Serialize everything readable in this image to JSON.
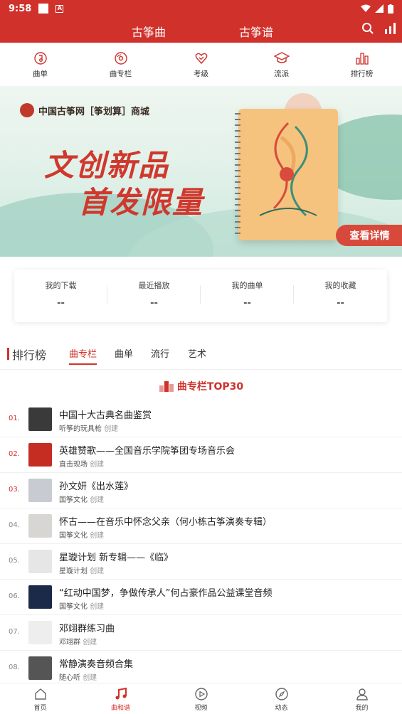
{
  "status": {
    "time": "9:58",
    "a_label": "A"
  },
  "tabs": {
    "left": "古筝曲",
    "right": "古筝谱"
  },
  "categories": [
    {
      "label": "曲单",
      "icon": "music-note-circle-icon"
    },
    {
      "label": "曲专栏",
      "icon": "album-icon"
    },
    {
      "label": "考级",
      "icon": "heart-certificate-icon"
    },
    {
      "label": "流派",
      "icon": "graduation-cap-icon"
    },
    {
      "label": "排行榜",
      "icon": "ranking-icon"
    }
  ],
  "banner": {
    "brand": "中国古筝网［筝划算］商城",
    "headline1": "文创新品",
    "headline2": "首发限量",
    "cta": "查看详情"
  },
  "stats": [
    {
      "label": "我的下载",
      "value": "--"
    },
    {
      "label": "最近播放",
      "value": "--"
    },
    {
      "label": "我的曲单",
      "value": "--"
    },
    {
      "label": "我的收藏",
      "value": "--"
    }
  ],
  "rank": {
    "title": "排行榜",
    "tabs": [
      "曲专栏",
      "曲单",
      "流行",
      "艺术"
    ],
    "active_tab": "曲专栏",
    "top_label": "曲专栏TOP30"
  },
  "items": [
    {
      "rank": "01.",
      "title": "中国十大古典名曲鉴赏",
      "author": "听筝的玩具枪",
      "suffix": "创建",
      "thumb": "#3a3a3a"
    },
    {
      "rank": "02.",
      "title": "英雄赞歌——全国音乐学院筝团专场音乐会",
      "author": "直击现场",
      "suffix": "创建",
      "thumb": "#c62d22"
    },
    {
      "rank": "03.",
      "title": "孙文妍《出水莲》",
      "author": "国筝文化",
      "suffix": "创建",
      "thumb": "#c9cbd3"
    },
    {
      "rank": "04.",
      "title": "怀古——在音乐中怀念父亲（何小栋古筝演奏专辑）",
      "author": "国筝文化",
      "suffix": "创建",
      "thumb": "#d8d6d2"
    },
    {
      "rank": "05.",
      "title": "星璇计划 新专辑——《临》",
      "author": "星璇计划",
      "suffix": "创建",
      "thumb": "#e6e6e6"
    },
    {
      "rank": "06.",
      "title": "“红动中国梦，争做传承人”何占豪作品公益课堂音频",
      "author": "国筝文化",
      "suffix": "创建",
      "thumb": "#1c2a4a"
    },
    {
      "rank": "07.",
      "title": "邓翊群练习曲",
      "author": "邓翊群",
      "suffix": "创建",
      "thumb": "#eeeeee"
    },
    {
      "rank": "08.",
      "title": "常静演奏音频合集",
      "author": "随心听",
      "suffix": "创建",
      "thumb": "#555555"
    }
  ],
  "bottom_nav": [
    {
      "label": "首页",
      "icon": "home-icon"
    },
    {
      "label": "曲和谱",
      "icon": "music-icon"
    },
    {
      "label": "视频",
      "icon": "video-icon"
    },
    {
      "label": "动态",
      "icon": "compass-icon"
    },
    {
      "label": "我的",
      "icon": "user-icon"
    }
  ],
  "colors": {
    "primary": "#d0312b"
  }
}
